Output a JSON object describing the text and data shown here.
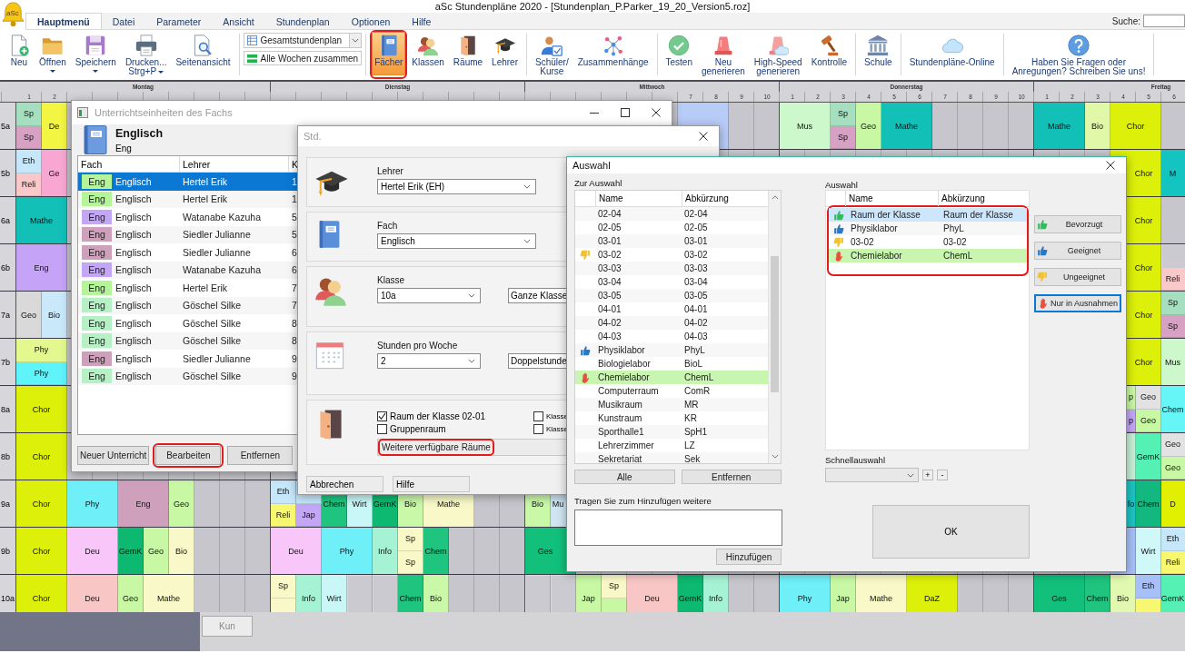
{
  "window": {
    "title": "aSc Stundenpläne 2020  - [Stundenplan_P.Parker_19_20_Version5.roz]"
  },
  "app_logo": {
    "text": "aSc"
  },
  "menu_tabs": [
    {
      "label": "Hauptmenü",
      "selected": true
    },
    {
      "label": "Datei",
      "selected": false
    },
    {
      "label": "Parameter",
      "selected": false
    },
    {
      "label": "Ansicht",
      "selected": false
    },
    {
      "label": "Stundenplan",
      "selected": false
    },
    {
      "label": "Optionen",
      "selected": false
    },
    {
      "label": "Hilfe",
      "selected": false
    }
  ],
  "search": {
    "label": "Suche:"
  },
  "ribbon": [
    {
      "kind": "buttons",
      "items": [
        {
          "label": "Neu",
          "dropdown": false,
          "selected": false,
          "highlighted": false
        },
        {
          "label": "Öffnen",
          "dropdown": true,
          "selected": false,
          "highlighted": false
        },
        {
          "label": "Speichern",
          "dropdown": true,
          "selected": false,
          "highlighted": false
        },
        {
          "label": "Drucken...\nStrg+P",
          "dropdown": true,
          "selected": false,
          "highlighted": false
        },
        {
          "label": "Seitenansicht",
          "dropdown": false,
          "selected": false,
          "highlighted": false
        }
      ]
    },
    {
      "kind": "view",
      "select": "Gesamtstundenplan",
      "button": "Alle Wochen zusammen"
    },
    {
      "kind": "buttons",
      "items": [
        {
          "label": "Fächer",
          "dropdown": false,
          "selected": true,
          "highlighted": true
        },
        {
          "label": "Klassen",
          "dropdown": false,
          "selected": false,
          "highlighted": false
        },
        {
          "label": "Räume",
          "dropdown": false,
          "selected": false,
          "highlighted": false
        },
        {
          "label": "Lehrer",
          "dropdown": false,
          "selected": false,
          "highlighted": false
        }
      ]
    },
    {
      "kind": "buttons",
      "items": [
        {
          "label": "Schüler/\nKurse",
          "dropdown": false,
          "selected": false,
          "highlighted": false
        },
        {
          "label": "Zusammenhänge",
          "dropdown": false,
          "selected": false,
          "highlighted": false
        }
      ]
    },
    {
      "kind": "buttons",
      "items": [
        {
          "label": "Testen",
          "dropdown": false,
          "selected": false,
          "highlighted": false
        },
        {
          "label": "Neu\ngenerieren",
          "dropdown": false,
          "selected": false,
          "highlighted": false
        },
        {
          "label": "High-Speed\ngenerieren",
          "dropdown": false,
          "selected": false,
          "highlighted": false
        },
        {
          "label": "Kontrolle",
          "dropdown": false,
          "selected": false,
          "highlighted": false
        }
      ]
    },
    {
      "kind": "buttons",
      "items": [
        {
          "label": "Schule",
          "dropdown": false,
          "selected": false,
          "highlighted": false
        }
      ]
    },
    {
      "kind": "buttons",
      "items": [
        {
          "label": "Stundenpläne-Online",
          "dropdown": false,
          "selected": false,
          "highlighted": false
        }
      ]
    },
    {
      "kind": "buttons",
      "items": [
        {
          "label": "Haben Sie Fragen oder\nAnregungen? Schreiben Sie uns!",
          "dropdown": false,
          "selected": false,
          "highlighted": false
        }
      ]
    }
  ],
  "timetable": {
    "days": [
      {
        "name": "Montag",
        "periods": [
          "1",
          "2"
        ]
      },
      {
        "name": "Dienstag"
      },
      {
        "name": "Mittwoch",
        "periods": [
          "7",
          "8",
          "9",
          "10"
        ]
      },
      {
        "name": "Donnerstag",
        "periods": [
          "1",
          "2",
          "3",
          "4",
          "5",
          "6",
          "7",
          "8",
          "9",
          "10"
        ]
      },
      {
        "name": "Freitag",
        "periods": [
          "1",
          "2",
          "3",
          "4",
          "5",
          "6"
        ]
      }
    ],
    "rows": [
      {
        "class": "5a",
        "mon": [
          {
            "kind": "split",
            "parts": [
              {
                "kind": "lesson",
                "text": "Sp",
                "color": "#a6dfc0"
              },
              {
                "kind": "lesson",
                "text": "Sp",
                "color": "#d7a1c4"
              }
            ]
          },
          {
            "kind": "single",
            "text": "De",
            "color": "#f2f542"
          }
        ],
        "wed": [
          {
            "kind": "covered"
          },
          {
            "kind": "covered"
          },
          {
            "kind": "covered"
          },
          {
            "kind": "covered"
          },
          {
            "kind": "covered"
          },
          {
            "kind": "covered"
          },
          {
            "kind": "double",
            "color": "#b8ccf8"
          }
        ],
        "thu": [
          {
            "kind": "double",
            "text": "Mus",
            "color": "#ccf8cc"
          },
          {
            "kind": "split",
            "parts": [
              {
                "kind": "lesson",
                "text": "Sp",
                "color": "#a6dfc0"
              },
              {
                "kind": "lesson",
                "text": "Sp",
                "color": "#d7a1c4"
              }
            ]
          },
          {
            "kind": "single",
            "text": "Geo",
            "color": "#c8f8a4"
          },
          {
            "kind": "double",
            "text": "Mathe",
            "color": "#12c0b8"
          }
        ],
        "fri": [
          {
            "kind": "double",
            "text": "Mathe",
            "color": "#12c0b8"
          },
          {
            "kind": "single",
            "text": "Bio",
            "color": "#e0f8a8"
          },
          {
            "kind": "double",
            "text": "Chor",
            "color": "#dcf00a"
          }
        ]
      },
      {
        "class": "5b",
        "mon": [
          {
            "kind": "split",
            "parts": [
              {
                "kind": "lesson",
                "text": "Eth",
                "color": "#c6e6fa"
              },
              {
                "kind": "lesson",
                "text": "Reli",
                "color": "#f9c9c9"
              }
            ]
          },
          {
            "kind": "single",
            "text": "Ge",
            "color": "#f7a7d1"
          }
        ],
        "fri": [
          {
            "kind": "covered"
          },
          {
            "kind": "covered"
          },
          {
            "kind": "covered"
          },
          {
            "kind": "double",
            "text": "Chor",
            "color": "#dcf00a"
          },
          {
            "kind": "single",
            "text": "M",
            "color": "#14c4c0"
          }
        ]
      },
      {
        "class": "6a",
        "mon": [
          {
            "kind": "double",
            "text": "Mathe",
            "color": "#12c0b8"
          }
        ],
        "fri": [
          {
            "kind": "covered"
          },
          {
            "kind": "covered"
          },
          {
            "kind": "covered"
          },
          {
            "kind": "double",
            "text": "Chor",
            "color": "#dcf00a"
          }
        ]
      },
      {
        "class": "6b",
        "mon": [
          {
            "kind": "double",
            "text": "Eng",
            "color": "#c5a3f7"
          }
        ],
        "fri": [
          {
            "kind": "covered"
          },
          {
            "kind": "covered"
          },
          {
            "kind": "covered"
          },
          {
            "kind": "double",
            "text": "Chor",
            "color": "#dcf00a"
          },
          {
            "kind": "split",
            "parts": [
              {
                "kind": "free"
              },
              {
                "kind": "lesson",
                "text": "Reli",
                "color": "#f9c9c9"
              }
            ]
          }
        ]
      },
      {
        "class": "7a",
        "mon": [
          {
            "kind": "single",
            "text": "Geo",
            "color": "#d9d9d9"
          },
          {
            "kind": "single",
            "text": "Bio",
            "color": "#c9e8fa"
          }
        ],
        "fri": [
          {
            "kind": "covered"
          },
          {
            "kind": "covered"
          },
          {
            "kind": "covered"
          },
          {
            "kind": "double",
            "text": "Chor",
            "color": "#dcf00a"
          },
          {
            "kind": "split",
            "parts": [
              {
                "kind": "lesson",
                "text": "Sp",
                "color": "#a6dfc0"
              },
              {
                "kind": "lesson",
                "text": "Sp",
                "color": "#d7a1c4"
              }
            ]
          }
        ]
      },
      {
        "class": "7b",
        "mon": [
          {
            "kind": "split_double",
            "parts": [
              {
                "kind": "lesson",
                "text": "Phy",
                "color": "#e3f98f"
              },
              {
                "kind": "lesson",
                "text": "Phy",
                "color": "#5ff3fa"
              }
            ]
          }
        ],
        "fri": [
          {
            "kind": "covered"
          },
          {
            "kind": "covered"
          },
          {
            "kind": "covered"
          },
          {
            "kind": "double",
            "text": "Chor",
            "color": "#dcf00a"
          },
          {
            "kind": "single",
            "text": "Mus",
            "color": "#ccf8cc"
          }
        ]
      },
      {
        "class": "8a",
        "mon": [
          {
            "kind": "double",
            "text": "Chor",
            "color": "#dcf00a"
          }
        ],
        "fri": [
          {
            "kind": "covered"
          },
          {
            "kind": "covered"
          },
          {
            "kind": "covered"
          },
          {
            "kind": "split",
            "parts": [
              {
                "kind": "lesson",
                "text": "p",
                "color": "#c8f8a4"
              },
              {
                "kind": "lesson",
                "text": "p",
                "color": "#c4a6f7"
              }
            ]
          },
          {
            "kind": "split",
            "parts": [
              {
                "kind": "lesson",
                "text": "Geo",
                "color": "#e2e2e2"
              },
              {
                "kind": "lesson",
                "text": "Geo",
                "color": "#c8f8a4"
              }
            ]
          },
          {
            "kind": "single",
            "text": "Chem",
            "color": "#66f6f8"
          }
        ]
      },
      {
        "class": "8b",
        "mon": [
          {
            "kind": "double",
            "text": "Chor",
            "color": "#dcf00a"
          }
        ],
        "fri": [
          {
            "kind": "covered"
          },
          {
            "kind": "covered"
          },
          {
            "kind": "covered"
          },
          {
            "kind": "single",
            "color": "#c8f0d8"
          },
          {
            "kind": "single",
            "text": "GemK",
            "color": "#55f0b4"
          },
          {
            "kind": "split",
            "parts": [
              {
                "kind": "lesson",
                "text": "Geo",
                "color": "#e2e2e2"
              },
              {
                "kind": "lesson",
                "text": "Geo",
                "color": "#c8f8a4"
              }
            ]
          }
        ]
      },
      {
        "class": "9a",
        "mon": [
          {
            "kind": "double",
            "text": "Chor",
            "color": "#dcf00a"
          },
          {
            "kind": "double",
            "text": "Phy",
            "color": "#6ff0f8"
          },
          {
            "kind": "double",
            "text": "Eng",
            "color": "#cfa0bc"
          },
          {
            "kind": "single",
            "text": "Geo",
            "color": "#c8f8a4"
          }
        ],
        "tue": [
          {
            "kind": "split",
            "parts": [
              {
                "kind": "lesson",
                "text": "Eth",
                "color": "#c6e6fa"
              },
              {
                "kind": "lesson",
                "text": "Reli",
                "color": "#f8f870"
              }
            ]
          },
          {
            "kind": "split",
            "parts": [
              {
                "kind": "lesson",
                "color": "#c6e6fa"
              },
              {
                "kind": "lesson",
                "text": "Jap",
                "color": "#c4a6f7"
              }
            ]
          },
          {
            "kind": "single",
            "text": "Chem",
            "color": "#1fc47e"
          },
          {
            "kind": "single",
            "text": "Wirt",
            "color": "#c9f7f7"
          },
          {
            "kind": "single",
            "text": "GemK",
            "color": "#0db870"
          },
          {
            "kind": "single",
            "text": "Bio",
            "color": "#c8f8a8"
          },
          {
            "kind": "double",
            "text": "Mathe",
            "color": "#f8f8c8"
          }
        ],
        "wed": [
          {
            "kind": "single",
            "text": "Bio",
            "color": "#c8f8a8"
          },
          {
            "kind": "single",
            "text": "Mu",
            "color": "#cfe6f2"
          }
        ],
        "fri": [
          {
            "kind": "covered"
          },
          {
            "kind": "covered"
          },
          {
            "kind": "covered"
          },
          {
            "kind": "single",
            "text": "fo",
            "color": "#1cc4c4"
          },
          {
            "kind": "single",
            "text": "Chem",
            "color": "#12b880"
          },
          {
            "kind": "single",
            "text": "D",
            "color": "#e0f000"
          }
        ]
      },
      {
        "class": "9b",
        "mon": [
          {
            "kind": "double",
            "text": "Chor",
            "color": "#dcf00a"
          },
          {
            "kind": "double",
            "text": "Deu",
            "color": "#f8c6f8"
          },
          {
            "kind": "single",
            "text": "GemK",
            "color": "#0db870"
          },
          {
            "kind": "single",
            "text": "Geo",
            "color": "#c8f8a4"
          },
          {
            "kind": "single",
            "text": "Bio",
            "color": "#f8f8c8"
          }
        ],
        "tue": [
          {
            "kind": "double",
            "text": "Deu",
            "color": "#f8c6f8"
          },
          {
            "kind": "double",
            "text": "Phy",
            "color": "#6ff0f8"
          },
          {
            "kind": "single",
            "text": "Info",
            "color": "#a5f2d5"
          },
          {
            "kind": "split",
            "parts": [
              {
                "kind": "lesson",
                "text": "Sp",
                "color": "#f8f8c8"
              },
              {
                "kind": "lesson",
                "text": "Sp",
                "color": "#f8f8c8"
              }
            ]
          },
          {
            "kind": "single",
            "text": "Chem",
            "color": "#1fc47e"
          }
        ],
        "wed": [
          {
            "kind": "double",
            "text": "Ges",
            "color": "#12c07c"
          }
        ],
        "fri": [
          {
            "kind": "covered"
          },
          {
            "kind": "covered"
          },
          {
            "kind": "covered"
          },
          {
            "kind": "single",
            "color": "#a8c0f8"
          },
          {
            "kind": "single",
            "text": "Wirt",
            "color": "#d0f8f8"
          },
          {
            "kind": "split",
            "parts": [
              {
                "kind": "lesson",
                "text": "Eth",
                "color": "#c6e6fa"
              },
              {
                "kind": "lesson",
                "text": "Reli",
                "color": "#f8f870"
              }
            ]
          }
        ]
      },
      {
        "class": "10a",
        "mon": [
          {
            "kind": "double",
            "text": "Chor",
            "color": "#dcf00a"
          },
          {
            "kind": "double",
            "text": "Deu",
            "color": "#f9c6c6"
          },
          {
            "kind": "single",
            "text": "Geo",
            "color": "#c8f8a4"
          },
          {
            "kind": "double",
            "text": "Mathe",
            "color": "#f8f8c8"
          }
        ],
        "tue": [
          {
            "kind": "split",
            "parts": [
              {
                "kind": "lesson",
                "text": "Sp",
                "color": "#f8f8c8"
              },
              {
                "kind": "lesson",
                "color": "#f8f8c8"
              }
            ]
          },
          {
            "kind": "single",
            "text": "Info",
            "color": "#a5f2d5"
          },
          {
            "kind": "single",
            "text": "Wirt",
            "color": "#c9f7f7"
          },
          {
            "kind": "free"
          },
          {
            "kind": "free"
          },
          {
            "kind": "single",
            "text": "Chem",
            "color": "#1fc47e"
          },
          {
            "kind": "single",
            "text": "Bio",
            "color": "#c8f8a8"
          }
        ],
        "wed": [
          {
            "kind": "free"
          },
          {
            "kind": "free"
          },
          {
            "kind": "single",
            "text": "Jap",
            "color": "#c8f8a4"
          },
          {
            "kind": "split",
            "parts": [
              {
                "kind": "lesson",
                "text": "Sp",
                "color": "#f8f8c8"
              },
              {
                "kind": "lesson",
                "color": "#c8f8a4"
              }
            ]
          },
          {
            "kind": "double",
            "text": "Deu",
            "color": "#f9c6c6"
          },
          {
            "kind": "single",
            "text": "GemK",
            "color": "#0db870"
          },
          {
            "kind": "single",
            "text": "Info",
            "color": "#a5f2d5"
          }
        ],
        "thu": [
          {
            "kind": "double",
            "text": "Phy",
            "color": "#6ff0f8"
          },
          {
            "kind": "single",
            "text": "Jap",
            "color": "#c8f8a4"
          },
          {
            "kind": "double",
            "text": "Mathe",
            "color": "#f8f8c8"
          },
          {
            "kind": "double",
            "text": "DaZ",
            "color": "#dcf00a"
          }
        ],
        "fri": [
          {
            "kind": "double",
            "text": "Ges",
            "color": "#12c07c"
          },
          {
            "kind": "single",
            "text": "Chem",
            "color": "#1fc47e"
          },
          {
            "kind": "single",
            "text": "Bio",
            "color": "#e0f8b0"
          },
          {
            "kind": "split",
            "parts": [
              {
                "kind": "lesson",
                "text": "Eth",
                "color": "#a8c0f8"
              },
              {
                "kind": "lesson",
                "color": "#f8f870"
              }
            ]
          },
          {
            "kind": "single",
            "text": "GemK",
            "color": "#55f0b4"
          }
        ]
      }
    ]
  },
  "lessons_dialog": {
    "title": "Unterrichtseinheiten des Fachs",
    "subject": {
      "name": "Englisch",
      "short": "Eng"
    },
    "columns": [
      "Fach",
      "Lehrer",
      "K"
    ],
    "rows": [
      {
        "badge": "Eng",
        "color": "#b4f59a",
        "subject": "Englisch",
        "teacher": "Hertel Erik",
        "column_3": "1",
        "selected": true
      },
      {
        "badge": "Eng",
        "color": "#b4f59a",
        "subject": "Englisch",
        "teacher": "Hertel Erik",
        "column_3": "1",
        "selected": false
      },
      {
        "badge": "Eng",
        "color": "#c4a6f7",
        "subject": "Englisch",
        "teacher": "Watanabe Kazuha",
        "column_3": "5",
        "selected": false
      },
      {
        "badge": "Eng",
        "color": "#cfa0bc",
        "subject": "Englisch",
        "teacher": "Siedler Julianne",
        "column_3": "5",
        "selected": false
      },
      {
        "badge": "Eng",
        "color": "#cfa0bc",
        "subject": "Englisch",
        "teacher": "Siedler Julianne",
        "column_3": "6",
        "selected": false
      },
      {
        "badge": "Eng",
        "color": "#c4a6f7",
        "subject": "Englisch",
        "teacher": "Watanabe Kazuha",
        "column_3": "6",
        "selected": false
      },
      {
        "badge": "Eng",
        "color": "#b4f59a",
        "subject": "Englisch",
        "teacher": "Hertel Erik",
        "column_3": "7",
        "selected": false
      },
      {
        "badge": "Eng",
        "color": "#b5f1c4",
        "subject": "Englisch",
        "teacher": "Göschel Silke",
        "column_3": "7",
        "selected": false
      },
      {
        "badge": "Eng",
        "color": "#b5f1c4",
        "subject": "Englisch",
        "teacher": "Göschel Silke",
        "column_3": "8",
        "selected": false
      },
      {
        "badge": "Eng",
        "color": "#b5f1c4",
        "subject": "Englisch",
        "teacher": "Göschel Silke",
        "column_3": "8",
        "selected": false
      },
      {
        "badge": "Eng",
        "color": "#cfa0bc",
        "subject": "Englisch",
        "teacher": "Siedler Julianne",
        "column_3": "9",
        "selected": false
      },
      {
        "badge": "Eng",
        "color": "#b5f1c4",
        "subject": "Englisch",
        "teacher": "Göschel Silke",
        "column_3": "9",
        "selected": false
      }
    ],
    "buttons": [
      {
        "label": "Neuer Unterricht",
        "highlighted": false
      },
      {
        "label": "Bearbeiten",
        "highlighted": true
      },
      {
        "label": "Entfernen",
        "highlighted": false
      }
    ]
  },
  "lesson_dialog": {
    "title": "Std.",
    "teacher": {
      "label": "Lehrer",
      "value": "Hertel Erik (EH)"
    },
    "subject": {
      "label": "Fach",
      "value": "Englisch"
    },
    "class_group": {
      "label": "Klasse",
      "value": "10a",
      "group": "Ganze Klasse"
    },
    "hours": {
      "label": "Stunden pro Woche",
      "value": "2",
      "length": "Doppelstunde"
    },
    "rooms": [
      {
        "label": "Raum der Klasse 02-01",
        "checked": true
      },
      {
        "label": "Gruppenraum",
        "checked": false
      },
      {
        "label": "Klasse",
        "checked": false
      },
      {
        "label": "Klasse",
        "checked": false
      }
    ],
    "more_rooms": {
      "label": "Weitere verfügbare Räume",
      "highlighted": true
    },
    "buttons": [
      "Abbrechen",
      "Hilfe"
    ]
  },
  "selection_dialog": {
    "title": "Auswahl",
    "available": {
      "label": "Zur Auswahl",
      "columns": [
        "Name",
        "Abkürzung"
      ],
      "rows": [
        {
          "kind": "plain",
          "name": "02-04",
          "short": "02-04",
          "selected": false,
          "marked": false
        },
        {
          "kind": "plain",
          "name": "02-05",
          "short": "02-05",
          "selected": false,
          "marked": false
        },
        {
          "kind": "plain",
          "name": "03-01",
          "short": "03-01",
          "selected": false,
          "marked": false
        },
        {
          "kind": "unsuitable",
          "name": "03-02",
          "short": "03-02",
          "selected": false,
          "marked": false
        },
        {
          "kind": "plain",
          "name": "03-03",
          "short": "03-03",
          "selected": false,
          "marked": false
        },
        {
          "kind": "plain",
          "name": "03-04",
          "short": "03-04",
          "selected": false,
          "marked": false
        },
        {
          "kind": "plain",
          "name": "03-05",
          "short": "03-05",
          "selected": false,
          "marked": false
        },
        {
          "kind": "plain",
          "name": "04-01",
          "short": "04-01",
          "selected": false,
          "marked": false
        },
        {
          "kind": "plain",
          "name": "04-02",
          "short": "04-02",
          "selected": false,
          "marked": false
        },
        {
          "kind": "plain",
          "name": "04-03",
          "short": "04-03",
          "selected": false,
          "marked": false
        },
        {
          "kind": "suitable",
          "name": "Physiklabor",
          "short": "PhyL",
          "selected": false,
          "marked": false
        },
        {
          "kind": "plain",
          "name": "Biologielabor",
          "short": "BioL",
          "selected": false,
          "marked": false
        },
        {
          "kind": "exception",
          "name": "Chemielabor",
          "short": "ChemL",
          "selected": false,
          "marked": true
        },
        {
          "kind": "plain",
          "name": "Computerraum",
          "short": "ComR",
          "selected": false,
          "marked": false
        },
        {
          "kind": "plain",
          "name": "Musikraum",
          "short": "MR",
          "selected": false,
          "marked": false
        },
        {
          "kind": "plain",
          "name": "Kunstraum",
          "short": "KR",
          "selected": false,
          "marked": false
        },
        {
          "kind": "plain",
          "name": "Sporthalle1",
          "short": "SpH1",
          "selected": false,
          "marked": false
        },
        {
          "kind": "plain",
          "name": "Lehrerzimmer",
          "short": "LZ",
          "selected": false,
          "marked": false
        },
        {
          "kind": "plain",
          "name": "Sekretariat",
          "short": "Sek",
          "selected": false,
          "marked": false
        }
      ]
    },
    "available_buttons": [
      "Alle",
      "Entfernen"
    ],
    "add": {
      "label": "Tragen Sie zum Hinzufügen weitere",
      "button": "Hinzufügen"
    },
    "chosen": {
      "label": "Auswahl",
      "columns": [
        "Name",
        "Abkürzung"
      ],
      "highlighted": true,
      "rows": [
        {
          "kind": "preferred",
          "name": "Raum der Klasse",
          "short": "Raum der Klasse",
          "selected": true,
          "marked": false
        },
        {
          "kind": "suitable",
          "name": "Physiklabor",
          "short": "PhyL",
          "selected": false,
          "marked": false
        },
        {
          "kind": "unsuitable",
          "name": "03-02",
          "short": "03-02",
          "selected": false,
          "marked": false
        },
        {
          "kind": "exception",
          "name": "Chemielabor",
          "short": "ChemL",
          "selected": false,
          "marked": true
        }
      ]
    },
    "rating_buttons": [
      {
        "label": "Bevorzugt",
        "focused": false
      },
      {
        "label": "Geeignet",
        "focused": false
      },
      {
        "label": "Ungeeignet",
        "focused": false
      },
      {
        "label": "Nur in Ausnahmen",
        "focused": true
      }
    ],
    "quick_select": {
      "label": "Schnellauswahl",
      "add": "+",
      "remove": "-"
    },
    "ok": "OK"
  },
  "bottom_panel": {
    "button": {
      "label": "Kun",
      "disabled": true
    }
  }
}
